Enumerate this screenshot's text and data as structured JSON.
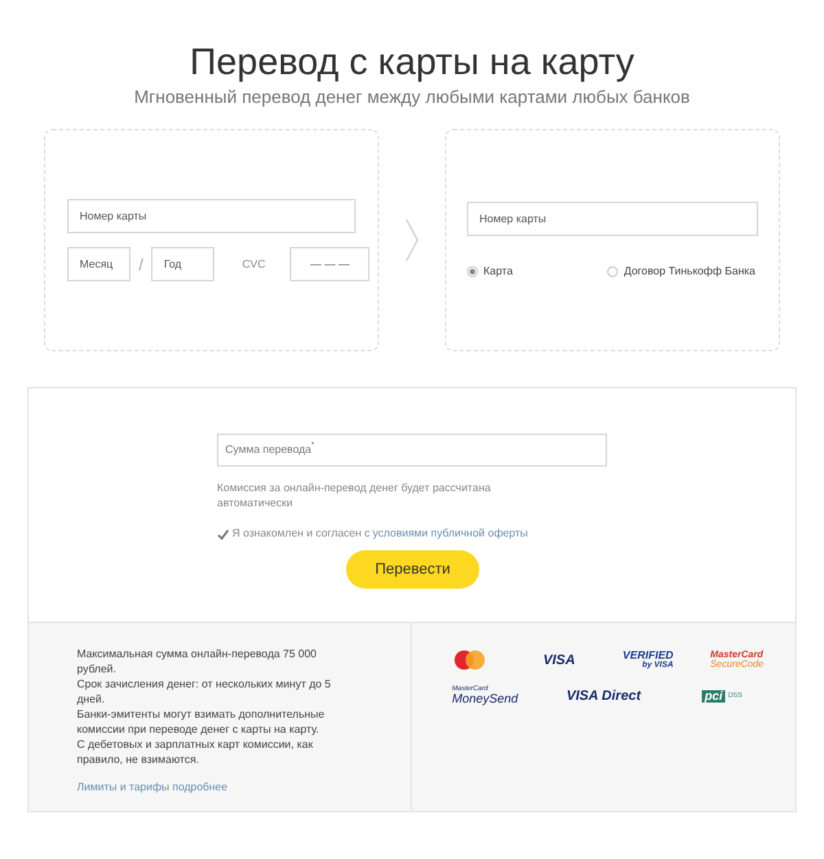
{
  "title": "Перевод с карты на карту",
  "subtitle": "Мгновенный перевод денег между любыми картами любых банков",
  "from_card": {
    "number": {
      "placeholder": "Номер карты"
    },
    "month": {
      "placeholder": "Месяц"
    },
    "separator": "/",
    "year": {
      "placeholder": "Год"
    },
    "cvc_label": "CVC",
    "cvc": {
      "placeholder": "— — —"
    }
  },
  "to_card": {
    "number": {
      "placeholder": "Номер карты"
    },
    "options": [
      {
        "label": "Карта",
        "selected": true
      },
      {
        "label": "Договор Тинькофф Банка",
        "selected": false
      }
    ]
  },
  "amount": {
    "placeholder": "Сумма перевода",
    "required_mark": "*"
  },
  "commission_note": "Комиссия за онлайн-перевод денег будет рассчитана автоматически",
  "agreement": {
    "checked": true,
    "text": "Я ознакомлен и согласен с ",
    "link": "условиями публичной оферты"
  },
  "submit": "Перевести",
  "info": [
    "Максимальная сумма онлайн-перевода 75 000 рублей.",
    "Срок зачисления денег: от нескольких минут до 5 дней.",
    "Банки-эмитенты могут взимать дополнительные комиссии при переводе денег с карты на карту.",
    "С дебетовых и зарплатных карт комиссии, как правило, не взимаются."
  ],
  "info_link": "Лимиты и тарифы подробнее",
  "logos": [
    {
      "kind": "mastercard"
    },
    {
      "kind": "visa",
      "text": "VISA"
    },
    {
      "kind": "verified",
      "text": "VERIFIED",
      "sub": "by VISA"
    },
    {
      "kind": "securecode",
      "text": "MasterCard",
      "sub": "SecureCode"
    },
    {
      "kind": "moneysend",
      "text": "MasterCard",
      "sub": "MoneySend"
    },
    {
      "kind": "visa",
      "text": "VISA Direct"
    },
    {
      "kind": "pci",
      "text": "pci",
      "sub": "DSS"
    }
  ]
}
